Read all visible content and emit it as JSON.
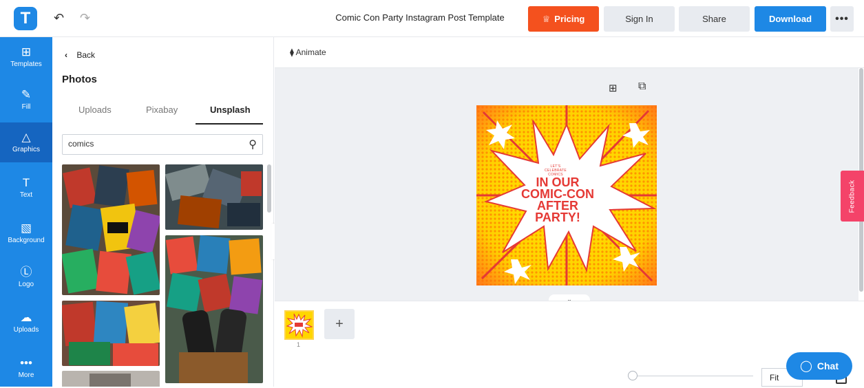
{
  "app": {
    "logo_letter": "T"
  },
  "header": {
    "title": "Comic Con Party Instagram Post Template",
    "undo_icon": "undo-icon",
    "redo_icon": "redo-icon",
    "pricing_label": "Pricing",
    "signin_label": "Sign In",
    "share_label": "Share",
    "download_label": "Download",
    "more_label": "•••"
  },
  "rail": [
    {
      "label": "Templates",
      "icon": "templates-icon",
      "glyph": "⊞"
    },
    {
      "label": "Fill",
      "icon": "pencil-icon",
      "glyph": "✎"
    },
    {
      "label": "Graphics",
      "icon": "shapes-icon",
      "glyph": "△"
    },
    {
      "label": "Text",
      "icon": "text-icon",
      "glyph": "T"
    },
    {
      "label": "Background",
      "icon": "background-icon",
      "glyph": "▧"
    },
    {
      "label": "Logo",
      "icon": "logo-icon",
      "glyph": "Ⓛ"
    },
    {
      "label": "Uploads",
      "icon": "cloud-upload-icon",
      "glyph": "☁"
    },
    {
      "label": "More",
      "icon": "more-icon",
      "glyph": "•••"
    }
  ],
  "panel": {
    "back_label": "Back",
    "title": "Photos",
    "tabs": [
      "Uploads",
      "Pixabay",
      "Unsplash"
    ],
    "active_tab": "Unsplash",
    "search_value": "comics"
  },
  "canvas": {
    "animate_label": "Animate",
    "design_subtitle": "LET'S CELEBRATE COMICS",
    "design_headline": "IN OUR COMIC-CON AFTER PARTY!",
    "page_number": "1"
  },
  "footer": {
    "zoom_label": "Fit",
    "chat_label": "Chat",
    "feedback_label": "Feedback"
  },
  "colors": {
    "brand": "#1e88e5",
    "pricing": "#f4511e",
    "feedback": "#f44369",
    "design_red": "#e53935",
    "design_yellow": "#ffd600"
  }
}
